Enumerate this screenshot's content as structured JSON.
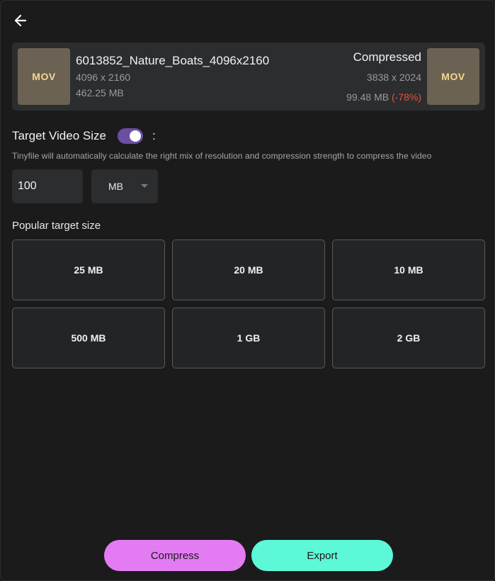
{
  "source": {
    "thumb_label": "MOV",
    "file_name": "6013852_Nature_Boats_4096x2160",
    "resolution": "4096 x 2160",
    "size": "462.25 MB"
  },
  "compressed": {
    "title": "Compressed",
    "thumb_label": "MOV",
    "resolution": "3838 x 2024",
    "size": "99.48 MB",
    "reduction": "(-78%)"
  },
  "target": {
    "label": "Target Video Size",
    "toggle_on": true,
    "colon": ":",
    "hint": "Tinyfile will automatically calculate the right mix of resolution and compression strength to compress the video",
    "value": "100",
    "unit": "MB"
  },
  "popular": {
    "label": "Popular target size",
    "presets": [
      "25 MB",
      "20 MB",
      "10 MB",
      "500 MB",
      "1 GB",
      "2 GB"
    ]
  },
  "actions": {
    "compress_label": "Compress",
    "export_label": "Export"
  },
  "colors": {
    "accent_toggle": "#6a4fa3",
    "compress": "#e37cf3",
    "export": "#5cf8d8",
    "reduction": "#e5533f"
  }
}
